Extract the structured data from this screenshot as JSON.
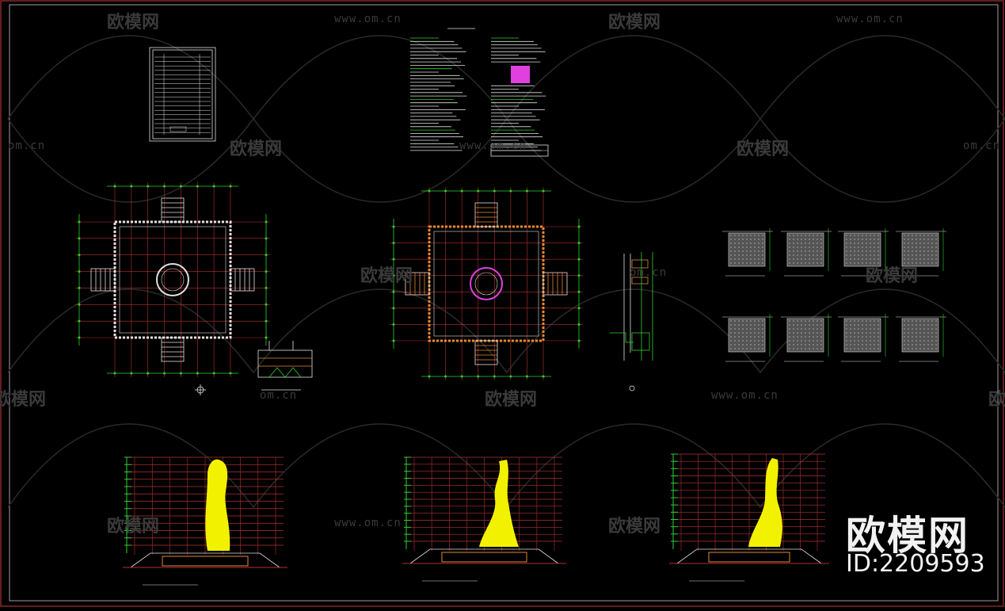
{
  "watermark": {
    "brand_text": "欧模网",
    "url_text": "www.om.cn",
    "url_partial": "om.cn"
  },
  "brand": {
    "name": "欧模网",
    "id_label": "ID:2209593"
  },
  "colors": {
    "background": "#000000",
    "frame": "#c83a3a",
    "grid_green": "#2fd12f",
    "grid_red": "#b53030",
    "wall_orange": "#e08a30",
    "sculpture_yellow": "#f2f200",
    "magenta": "#e040e0",
    "white_line": "#e0e0e0",
    "watermark": "#3a3a3a"
  },
  "icons": {
    "watermark_logo": "sofa-icon"
  }
}
